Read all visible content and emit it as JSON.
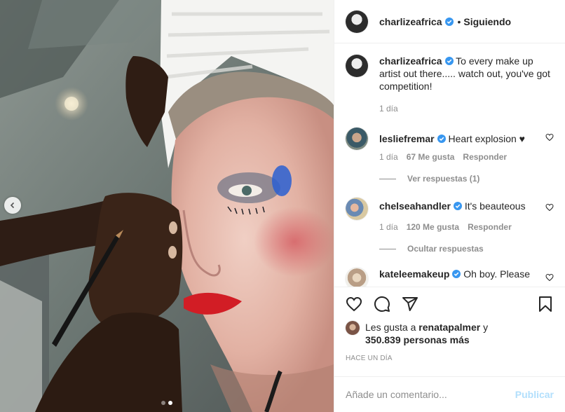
{
  "header": {
    "username": "charlizeafrica",
    "separator": "•",
    "follow_status": "Siguiendo"
  },
  "caption": {
    "username": "charlizeafrica",
    "text": "To every make up artist out there..... watch out, you've got competition!",
    "time": "1 día"
  },
  "comments": [
    {
      "username": "lesliefremar",
      "text": "Heart explosion ♥",
      "time": "1 día",
      "likes": "67 Me gusta",
      "reply_label": "Responder",
      "replies_label": "Ver respuestas (1)"
    },
    {
      "username": "chelseahandler",
      "text": "It's beauteous",
      "time": "1 día",
      "likes": "120 Me gusta",
      "reply_label": "Responder",
      "replies_label": "Ocultar respuestas"
    },
    {
      "username": "kateleemakeup",
      "text": "Oh boy. Please"
    }
  ],
  "likes_summary": {
    "prefix": "Les gusta a",
    "user": "renatapalmer",
    "joiner": "y",
    "others": "350.839 personas más"
  },
  "timestamp": "Hace un día",
  "comment_box": {
    "placeholder": "Añade un comentario...",
    "publish_label": "Publicar"
  },
  "icons": [
    "heart-icon",
    "comment-icon",
    "share-icon",
    "bookmark-icon",
    "verified-icon",
    "chevron-left-icon"
  ],
  "colors": {
    "verified": "#3897f0",
    "publish_disabled": "#b2dffc",
    "secondary_text": "#8e8e8e",
    "primary_text": "#262626"
  },
  "carousel": {
    "slides": 2,
    "active": 2
  }
}
